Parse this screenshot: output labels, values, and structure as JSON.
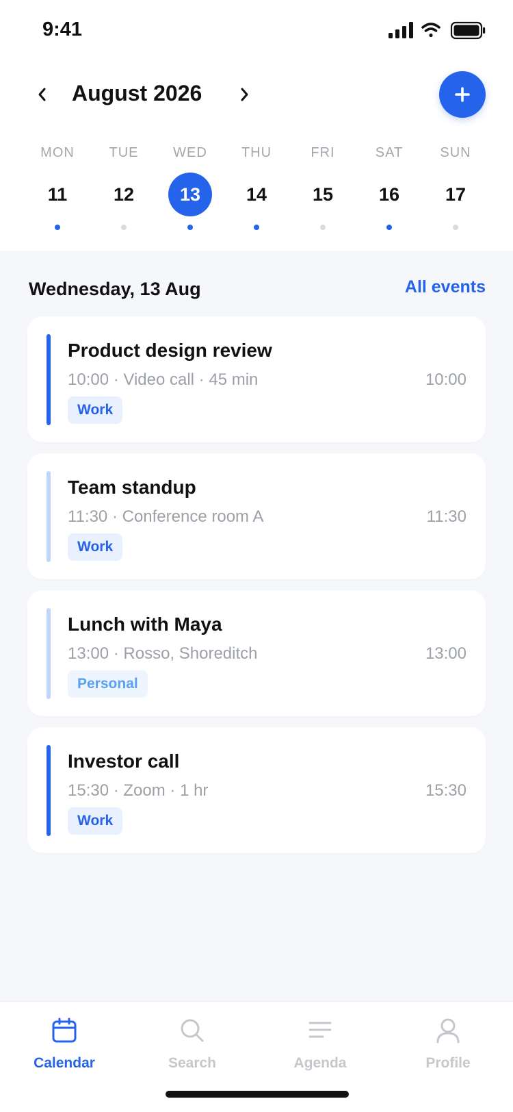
{
  "status_bar": {
    "time": "9:41"
  },
  "header": {
    "month_title": "August 2026",
    "prev_icon": "chevron-left-icon",
    "next_icon": "chevron-right-icon",
    "add_icon": "plus-icon"
  },
  "week": [
    {
      "name": "MON",
      "num": "11",
      "has_event": true,
      "selected": false
    },
    {
      "name": "TUE",
      "num": "12",
      "has_event": false,
      "selected": false
    },
    {
      "name": "WED",
      "num": "13",
      "has_event": true,
      "selected": true
    },
    {
      "name": "THU",
      "num": "14",
      "has_event": true,
      "selected": false
    },
    {
      "name": "FRI",
      "num": "15",
      "has_event": false,
      "selected": false
    },
    {
      "name": "SAT",
      "num": "16",
      "has_event": true,
      "selected": false
    },
    {
      "name": "SUN",
      "num": "17",
      "has_event": false,
      "selected": false
    }
  ],
  "agenda": {
    "date_heading": "Wednesday, 13 Aug",
    "all_events_label": "All events"
  },
  "events": [
    {
      "title": "Product design review",
      "subtitle": "10:00 · Video call · 45 min",
      "time": "10:00",
      "tag": "Work",
      "bar_color": "#2563eb",
      "tag_color": "#2563eb",
      "tag_bg": "#eaf1fe"
    },
    {
      "title": "Team standup",
      "subtitle": "11:30 · Conference room A",
      "time": "11:30",
      "tag": "Work",
      "bar_color": "#bfd6fb",
      "tag_color": "#2563eb",
      "tag_bg": "#eaf1fe"
    },
    {
      "title": "Lunch with Maya",
      "subtitle": "13:00 · Rosso, Shoreditch",
      "time": "13:00",
      "tag": "Personal",
      "bar_color": "#bfd6fb",
      "tag_color": "#5aa2f0",
      "tag_bg": "#eef5fe"
    },
    {
      "title": "Investor call",
      "subtitle": "15:30 · Zoom · 1 hr",
      "time": "15:30",
      "tag": "Work",
      "bar_color": "#2563eb",
      "tag_color": "#2563eb",
      "tag_bg": "#eaf1fe"
    }
  ],
  "tabs": [
    {
      "label": "Calendar",
      "icon": "calendar-icon",
      "active": true
    },
    {
      "label": "Search",
      "icon": "search-icon",
      "active": false
    },
    {
      "label": "Agenda",
      "icon": "list-icon",
      "active": false
    },
    {
      "label": "Profile",
      "icon": "person-icon",
      "active": false
    }
  ],
  "colors": {
    "accent": "#2563eb",
    "muted_dot": "#d9dbdf",
    "tab_inactive": "#c4c7cc"
  }
}
